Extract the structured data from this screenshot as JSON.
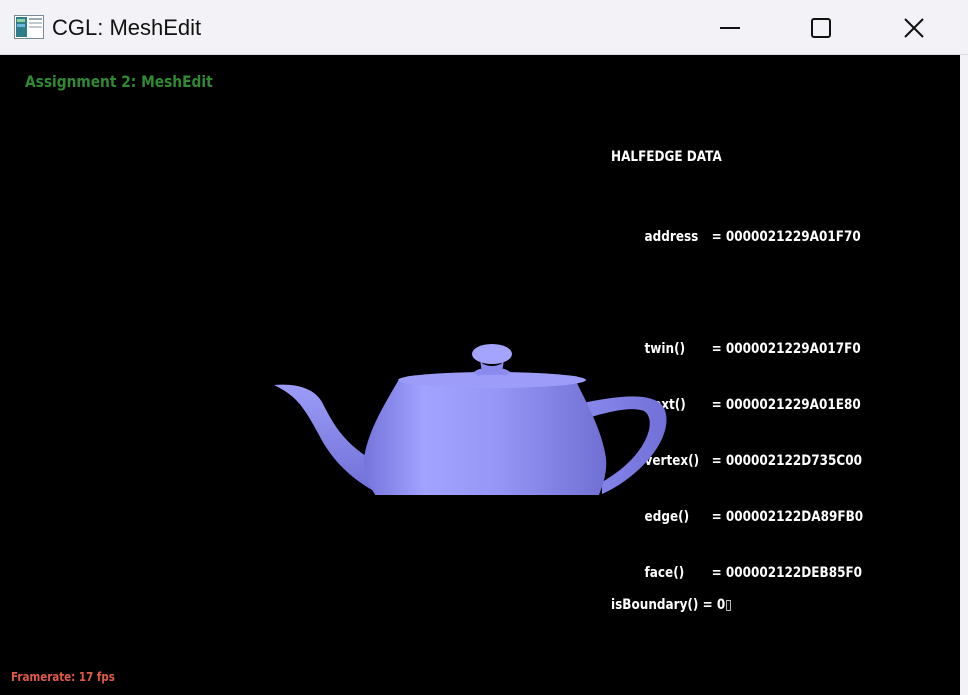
{
  "window": {
    "title": "CGL: MeshEdit"
  },
  "icons": {
    "app": "app-window-icon",
    "minimize": "minimize-icon",
    "maximize": "maximize-icon",
    "close": "close-icon"
  },
  "viewport": {
    "assignment_title": "Assignment 2: MeshEdit",
    "framerate": "Framerate: 17 fps"
  },
  "halfedge_panel": {
    "header": "HALFEDGE DATA",
    "rows": [
      {
        "key": "address",
        "value": "= 0000021229A01F70"
      },
      {
        "key": "twin()",
        "value": "= 0000021229A017F0"
      },
      {
        "key": "next()",
        "value": "= 0000021229A01E80"
      },
      {
        "key": "vertex()",
        "value": "= 000002122D735C00"
      },
      {
        "key": "edge()",
        "value": "= 000002122DA89FB0"
      },
      {
        "key": "face()",
        "value": "= 000002122DEB85F0"
      }
    ],
    "boundary": "isBoundary() = 0▯"
  },
  "colors": {
    "titlebar_bg": "#f3f3f7",
    "viewport_bg": "#000000",
    "assignment_title": "#2f8a33",
    "framerate": "#e05a45",
    "teapot": "#8f8ff5"
  }
}
